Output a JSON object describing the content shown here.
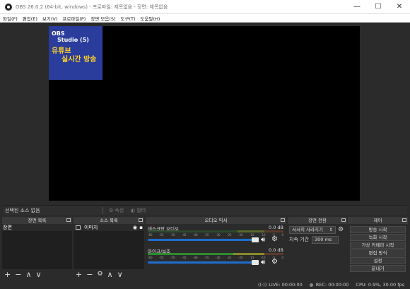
{
  "window": {
    "title": "OBS 26.0.2 (64-bit, windows) - 프로파일: 제목없음 - 장면: 제목없음",
    "minimize": "—",
    "maximize": "☐",
    "close": "✕"
  },
  "menu": [
    "파일(F)",
    "편집(E)",
    "보기(V)",
    "프로파일(P)",
    "장면 모음(S)",
    "도구(T)",
    "도움말(H)"
  ],
  "preview": {
    "thumb_line1": "OBS",
    "thumb_line2": "Studio (5)",
    "thumb_line3": "유튜브",
    "thumb_line4": "실시간 방송"
  },
  "context_bar": {
    "no_source": "선택된 소스 없음",
    "properties": "속성",
    "filters": "필터"
  },
  "docks": {
    "scenes": {
      "title": "장면 목록",
      "items": [
        "장면"
      ]
    },
    "sources": {
      "title": "소스 목록",
      "items": [
        "이미지"
      ]
    },
    "mixer": {
      "title": "오디오 믹서",
      "tracks": [
        {
          "name": "데스크탑 오디오",
          "db": "0.0 dB",
          "level": 0
        },
        {
          "name": "마이크/보조",
          "db": "0.0 dB",
          "level": 0.75
        }
      ],
      "ticks": [
        "-60",
        "-55",
        "-50",
        "-45",
        "-40",
        "-35",
        "-30",
        "-25",
        "-20",
        "-15",
        "-10",
        "-5",
        "0"
      ]
    },
    "transitions": {
      "title": "장면 전환",
      "selected": "서서히 사라지기",
      "duration_label": "지속 기간",
      "duration_value": "300 ms"
    },
    "controls": {
      "title": "제어",
      "buttons": [
        "방송 시작",
        "녹화 시작",
        "가상 카메라 시작",
        "편집 방식",
        "설정",
        "끝내기"
      ]
    }
  },
  "footer_icons": {
    "add": "+",
    "remove": "−",
    "up": "∧",
    "down": "∨",
    "gear": "⚙"
  },
  "status": {
    "live": "LIVE: 00:00:00",
    "rec": "REC: 00:00:00",
    "cpu": "CPU: 0.9%, 30.00 fps"
  }
}
